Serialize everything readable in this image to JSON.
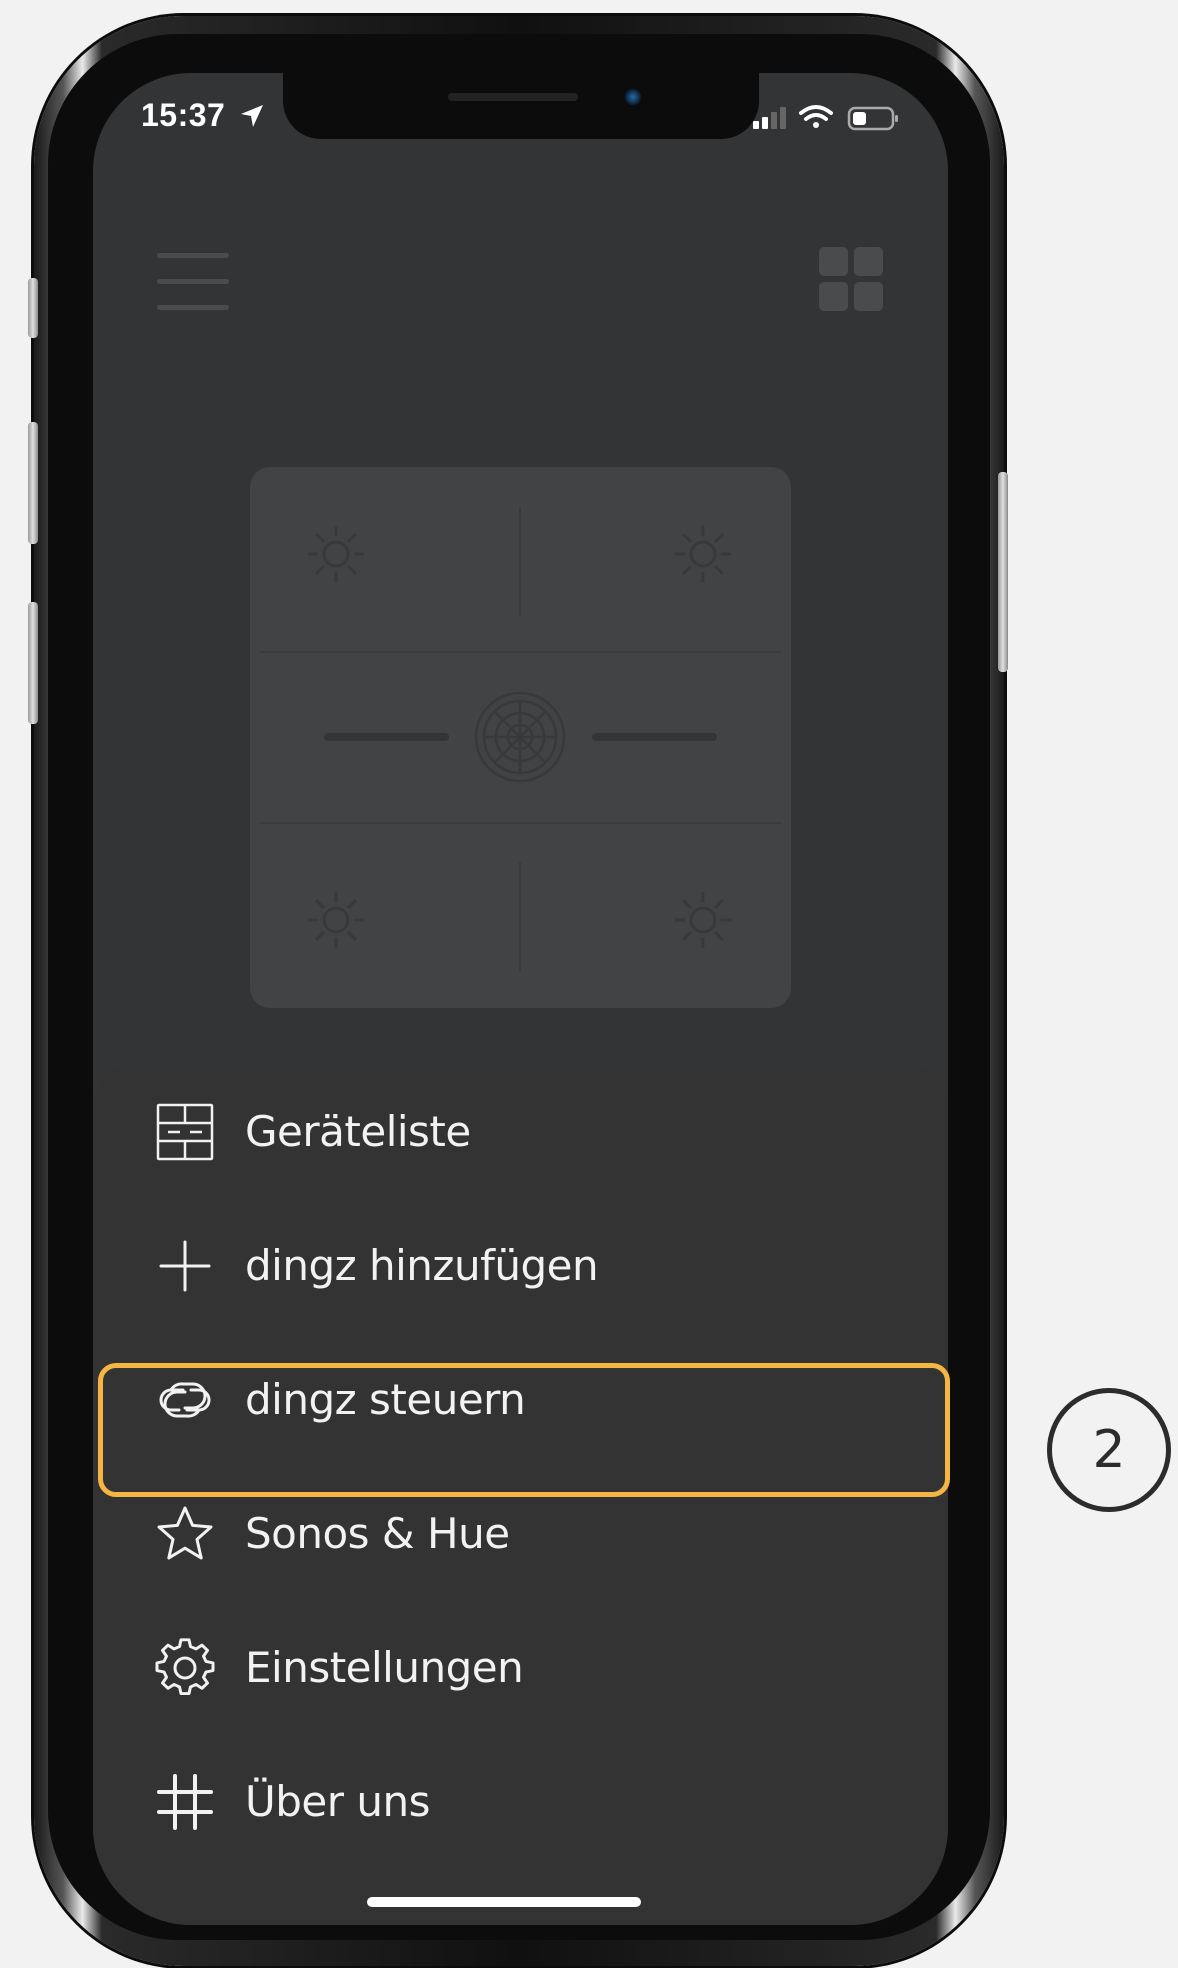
{
  "status_bar": {
    "time": "15:37"
  },
  "menu": {
    "items": [
      {
        "label": "Geräteliste",
        "icon": "device-list-icon"
      },
      {
        "label": "dingz hinzufügen",
        "icon": "plus-icon"
      },
      {
        "label": "dingz steuern",
        "icon": "link-icon",
        "highlighted": true
      },
      {
        "label": "Sonos & Hue",
        "icon": "star-icon"
      },
      {
        "label": "Einstellungen",
        "icon": "gear-icon"
      },
      {
        "label": "Über uns",
        "icon": "hashtag-icon"
      }
    ]
  },
  "callout": {
    "step_number": "2"
  },
  "colors": {
    "highlight": "#f5b545",
    "sheet": "#333333",
    "screen": "#333436"
  }
}
